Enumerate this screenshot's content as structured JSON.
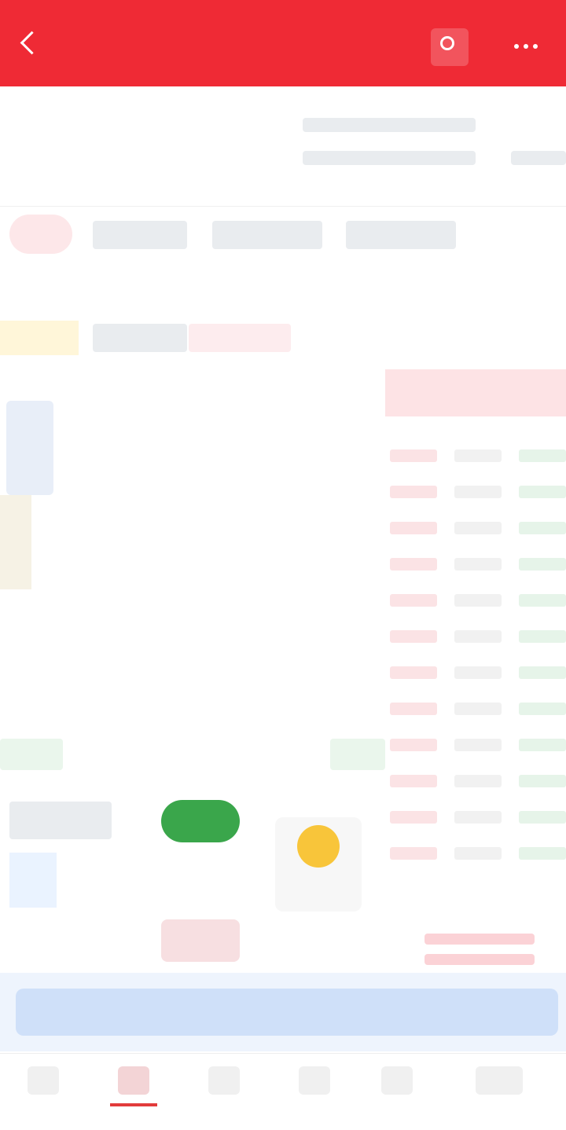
{
  "header": {
    "back_label": "",
    "title": "",
    "subtitle": "",
    "search_label": "",
    "more_label": ""
  },
  "quote": {
    "price": "",
    "change": "",
    "change_pct": "",
    "stats": [
      "",
      "",
      "",
      ""
    ]
  },
  "tabs": [
    {
      "label": ""
    },
    {
      "label": ""
    },
    {
      "label": ""
    },
    {
      "label": ""
    },
    {
      "label": ""
    },
    {
      "label": ""
    }
  ],
  "chart_tabs": [
    {
      "label": ""
    },
    {
      "label": ""
    },
    {
      "label": ""
    }
  ],
  "order_book": {
    "header": "",
    "rows": [
      {
        "price": "",
        "vol": "",
        "chg": ""
      },
      {
        "price": "",
        "vol": "",
        "chg": ""
      },
      {
        "price": "",
        "vol": "",
        "chg": ""
      },
      {
        "price": "",
        "vol": "",
        "chg": ""
      },
      {
        "price": "",
        "vol": "",
        "chg": ""
      },
      {
        "price": "",
        "vol": "",
        "chg": ""
      },
      {
        "price": "",
        "vol": "",
        "chg": ""
      },
      {
        "price": "",
        "vol": "",
        "chg": ""
      },
      {
        "price": "",
        "vol": "",
        "chg": ""
      },
      {
        "price": "",
        "vol": "",
        "chg": ""
      },
      {
        "price": "",
        "vol": "",
        "chg": ""
      },
      {
        "price": "",
        "vol": "",
        "chg": ""
      }
    ]
  },
  "actions": {
    "buy_label": "",
    "sell_label": "",
    "trade_label": ""
  },
  "banner": {
    "text": ""
  },
  "bottom_nav": [
    {
      "label": ""
    },
    {
      "label": ""
    },
    {
      "label": ""
    },
    {
      "label": ""
    },
    {
      "label": ""
    },
    {
      "label": ""
    }
  ],
  "colors": {
    "header_bg": "#ef2a35",
    "up": "#e23b3b",
    "down": "#2aa84a",
    "banner_bg": "#dbe8fb"
  }
}
